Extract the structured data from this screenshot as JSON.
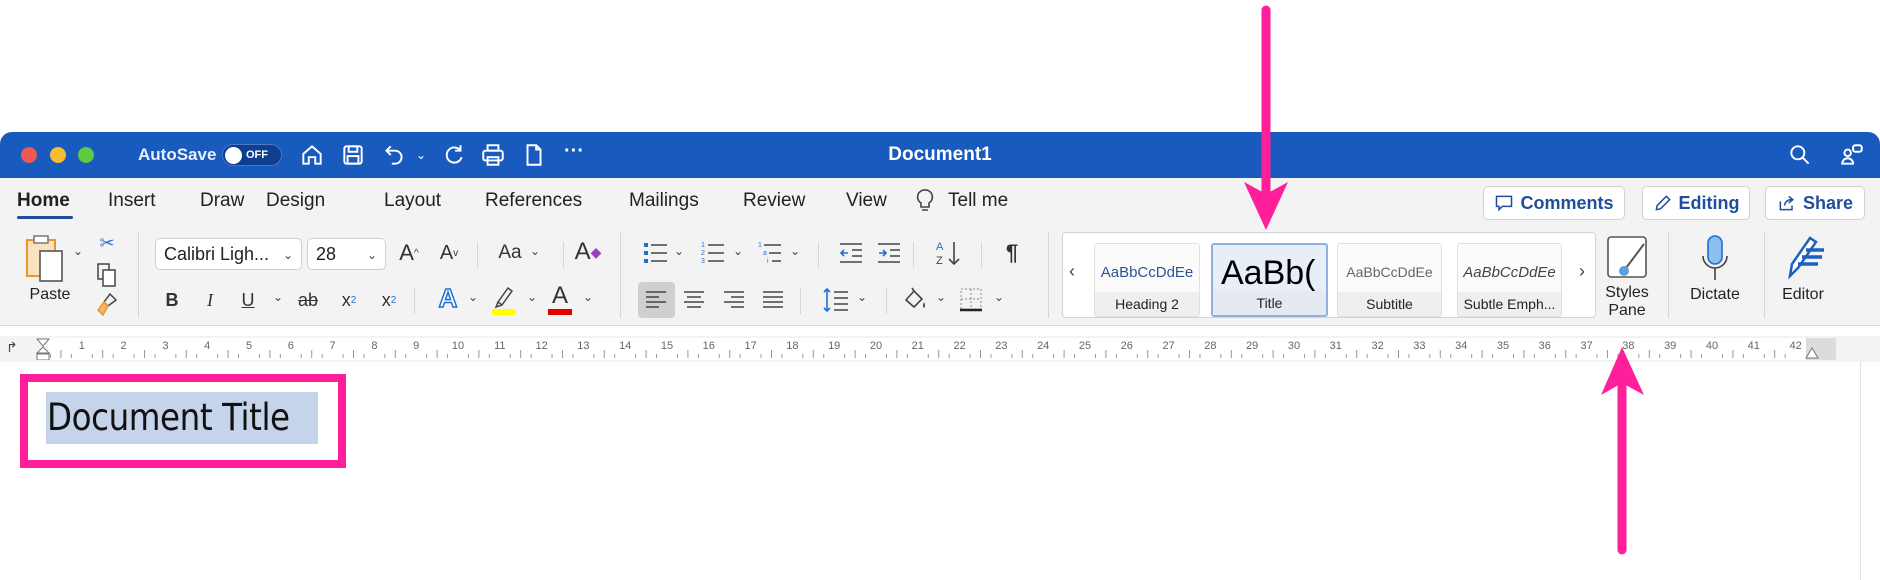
{
  "titlebar": {
    "autosave_label": "AutoSave",
    "autosave_state": "OFF",
    "document_title": "Document1"
  },
  "tabs": [
    {
      "label": "Home",
      "active": true
    },
    {
      "label": "Insert"
    },
    {
      "label": "Draw"
    },
    {
      "label": "Design"
    },
    {
      "label": "Layout"
    },
    {
      "label": "References"
    },
    {
      "label": "Mailings"
    },
    {
      "label": "Review"
    },
    {
      "label": "View"
    }
  ],
  "tell_me": "Tell me",
  "top_buttons": {
    "comments": "Comments",
    "editing": "Editing",
    "share": "Share"
  },
  "ribbon": {
    "paste_label": "Paste",
    "font_name": "Calibri Ligh...",
    "font_size": "28",
    "change_case": "Aa",
    "styles": [
      {
        "preview": "AaBbCcDdEe",
        "label": "Heading 2"
      },
      {
        "preview": "AaBb(",
        "label": "Title",
        "selected": true
      },
      {
        "preview": "AaBbCcDdEe",
        "label": "Subtitle"
      },
      {
        "preview": "AaBbCcDdEe",
        "label": "Subtle Emph..."
      }
    ],
    "styles_pane_label_1": "Styles",
    "styles_pane_label_2": "Pane",
    "dictate_label": "Dictate",
    "editor_label": "Editor",
    "highlight_color": "#ffff00",
    "font_color": "#e00000"
  },
  "ruler": {
    "labels": [
      "1",
      "2",
      "3",
      "4",
      "5",
      "6",
      "7",
      "8",
      "9",
      "10",
      "11",
      "12",
      "13",
      "14",
      "15",
      "16",
      "17",
      "18",
      "19",
      "20",
      "21",
      "22",
      "23",
      "24",
      "25",
      "26",
      "27",
      "28",
      "29",
      "30",
      "31",
      "32",
      "33",
      "34",
      "35",
      "36",
      "37",
      "38",
      "39",
      "40",
      "41",
      "42"
    ]
  },
  "document": {
    "text": "Document Title",
    "selected": true
  },
  "colors": {
    "titlebar": "#185abd",
    "annotation": "#ff1f9a",
    "selection": "#c5d3eb"
  }
}
